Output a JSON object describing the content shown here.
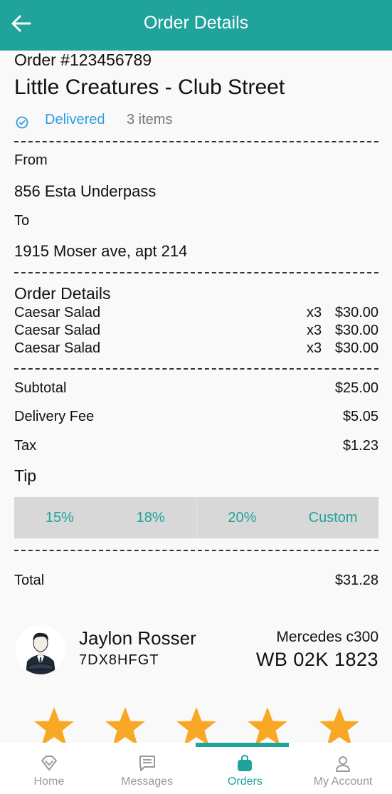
{
  "header": {
    "title": "Order Details"
  },
  "order": {
    "id": "Order #123456789",
    "store": "Little Creatures - Club Street",
    "status": "Delivered",
    "items_count": "3 items"
  },
  "route": {
    "from_label": "From",
    "from_address": "856 Esta Underpass",
    "to_label": "To",
    "to_address": "1915 Moser ave, apt 214"
  },
  "details": {
    "title": "Order Details",
    "items": [
      {
        "name": "Caesar Salad",
        "qty": "x3",
        "price": "$30.00"
      },
      {
        "name": "Caesar Salad",
        "qty": "x3",
        "price": "$30.00"
      },
      {
        "name": "Caesar Salad",
        "qty": "x3",
        "price": "$30.00"
      }
    ]
  },
  "summary": {
    "subtotal_label": "Subtotal",
    "subtotal": "$25.00",
    "delivery_label": "Delivery Fee",
    "delivery": "$5.05",
    "tax_label": "Tax",
    "tax": "$1.23",
    "tip_label": "Tip",
    "tip_options": [
      "15%",
      "18%",
      "20%",
      "Custom"
    ],
    "total_label": "Total",
    "total": "$31.28"
  },
  "driver": {
    "name": "Jaylon Rosser",
    "code": "7DX8HFGT",
    "car_model": "Mercedes c300",
    "plate": "WB 02K 1823"
  },
  "rating": {
    "stars": 5,
    "max": 5
  },
  "nav": {
    "items": [
      {
        "label": "Home",
        "icon": "home-icon"
      },
      {
        "label": "Messages",
        "icon": "message-icon"
      },
      {
        "label": "Orders",
        "icon": "shopping-bag-icon"
      },
      {
        "label": "My Account",
        "icon": "user-icon"
      }
    ],
    "active": "Orders"
  },
  "colors": {
    "primary": "#20a39b",
    "status": "#2f9de0",
    "star": "#f9a825"
  }
}
